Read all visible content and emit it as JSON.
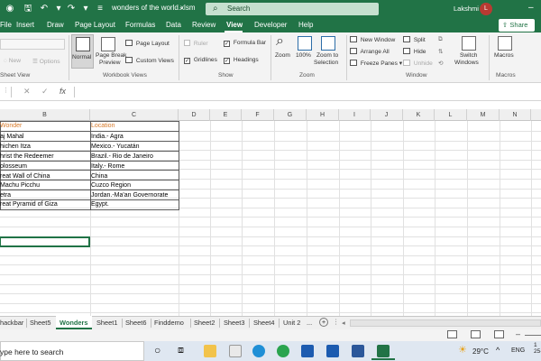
{
  "titlebar": {
    "doc_title": "wonders of the world.xlsm",
    "search_label": "Search",
    "user_name": "Lakshmi",
    "avatar_initial": "L"
  },
  "menu": {
    "tabs": [
      "File",
      "Insert",
      "Draw",
      "Page Layout",
      "Formulas",
      "Data",
      "Review",
      "View",
      "Developer",
      "Help"
    ],
    "active": "View",
    "share_label": "Share"
  },
  "ribbon": {
    "sheet_view": {
      "new": "New",
      "options": "Options",
      "group": "Sheet View"
    },
    "workbook_views": {
      "normal": "Normal",
      "page_break": "Page Break",
      "page_break2": "Preview",
      "page_layout": "Page Layout",
      "custom_views": "Custom Views",
      "group": "Workbook Views"
    },
    "show": {
      "ruler": "Ruler",
      "formula_bar": "Formula Bar",
      "gridlines": "Gridlines",
      "headings": "Headings",
      "group": "Show"
    },
    "zoom": {
      "zoom": "Zoom",
      "hundred": "100%",
      "zoom_sel1": "Zoom to",
      "zoom_sel2": "Selection",
      "group": "Zoom"
    },
    "window": {
      "new_window": "New Window",
      "arrange_all": "Arrange All",
      "freeze_panes": "Freeze Panes",
      "split": "Split",
      "hide": "Hide",
      "unhide": "Unhide",
      "switch1": "Switch",
      "switch2": "Windows",
      "group": "Window"
    },
    "macros": {
      "label": "Macros",
      "group": "Macros"
    }
  },
  "formula_bar": {
    "fx": "fx"
  },
  "grid": {
    "columns": [
      "B",
      "C",
      "D",
      "E",
      "F",
      "G",
      "H",
      "I",
      "J",
      "K",
      "L",
      "M",
      "N"
    ],
    "header": {
      "col_b": "Wonder",
      "col_c": "Location"
    },
    "rows": [
      {
        "wonder": "aj Mahal",
        "location": "India.- Agra"
      },
      {
        "wonder": "hichen Itza",
        "location": "Mexico.- Yucatán"
      },
      {
        "wonder": "hrist the Redeemer",
        "location": "Brazil.- Rio de Janeiro"
      },
      {
        "wonder": "olosseum",
        "location": "Italy.- Rome"
      },
      {
        "wonder": "reat Wall of China",
        "location": "China"
      },
      {
        "wonder": "Machu Picchu",
        "location": "Cuzco Region"
      },
      {
        "wonder": "etra",
        "location": "Jordan.-Ma'an Governorate"
      },
      {
        "wonder": "reat Pyramid of Giza",
        "location": "Egypt."
      }
    ]
  },
  "sheet_tabs": {
    "tabs": [
      "hackbar",
      "Sheet5",
      "Wonders",
      "Sheet1",
      "Sheet6",
      "Finddemo",
      "Sheet2",
      "Sheet3",
      "Sheet4",
      "Unit 2"
    ],
    "active": "Wonders",
    "more": "...",
    "add": "+"
  },
  "taskbar": {
    "search_text": "ype here to search",
    "temperature": "29°C",
    "language": "ENG",
    "clock_time": "1",
    "clock_date": "25-1"
  },
  "colors": {
    "excel_green": "#217346",
    "header_orange": "#d77a2a",
    "avatar_red": "#b93a32"
  }
}
